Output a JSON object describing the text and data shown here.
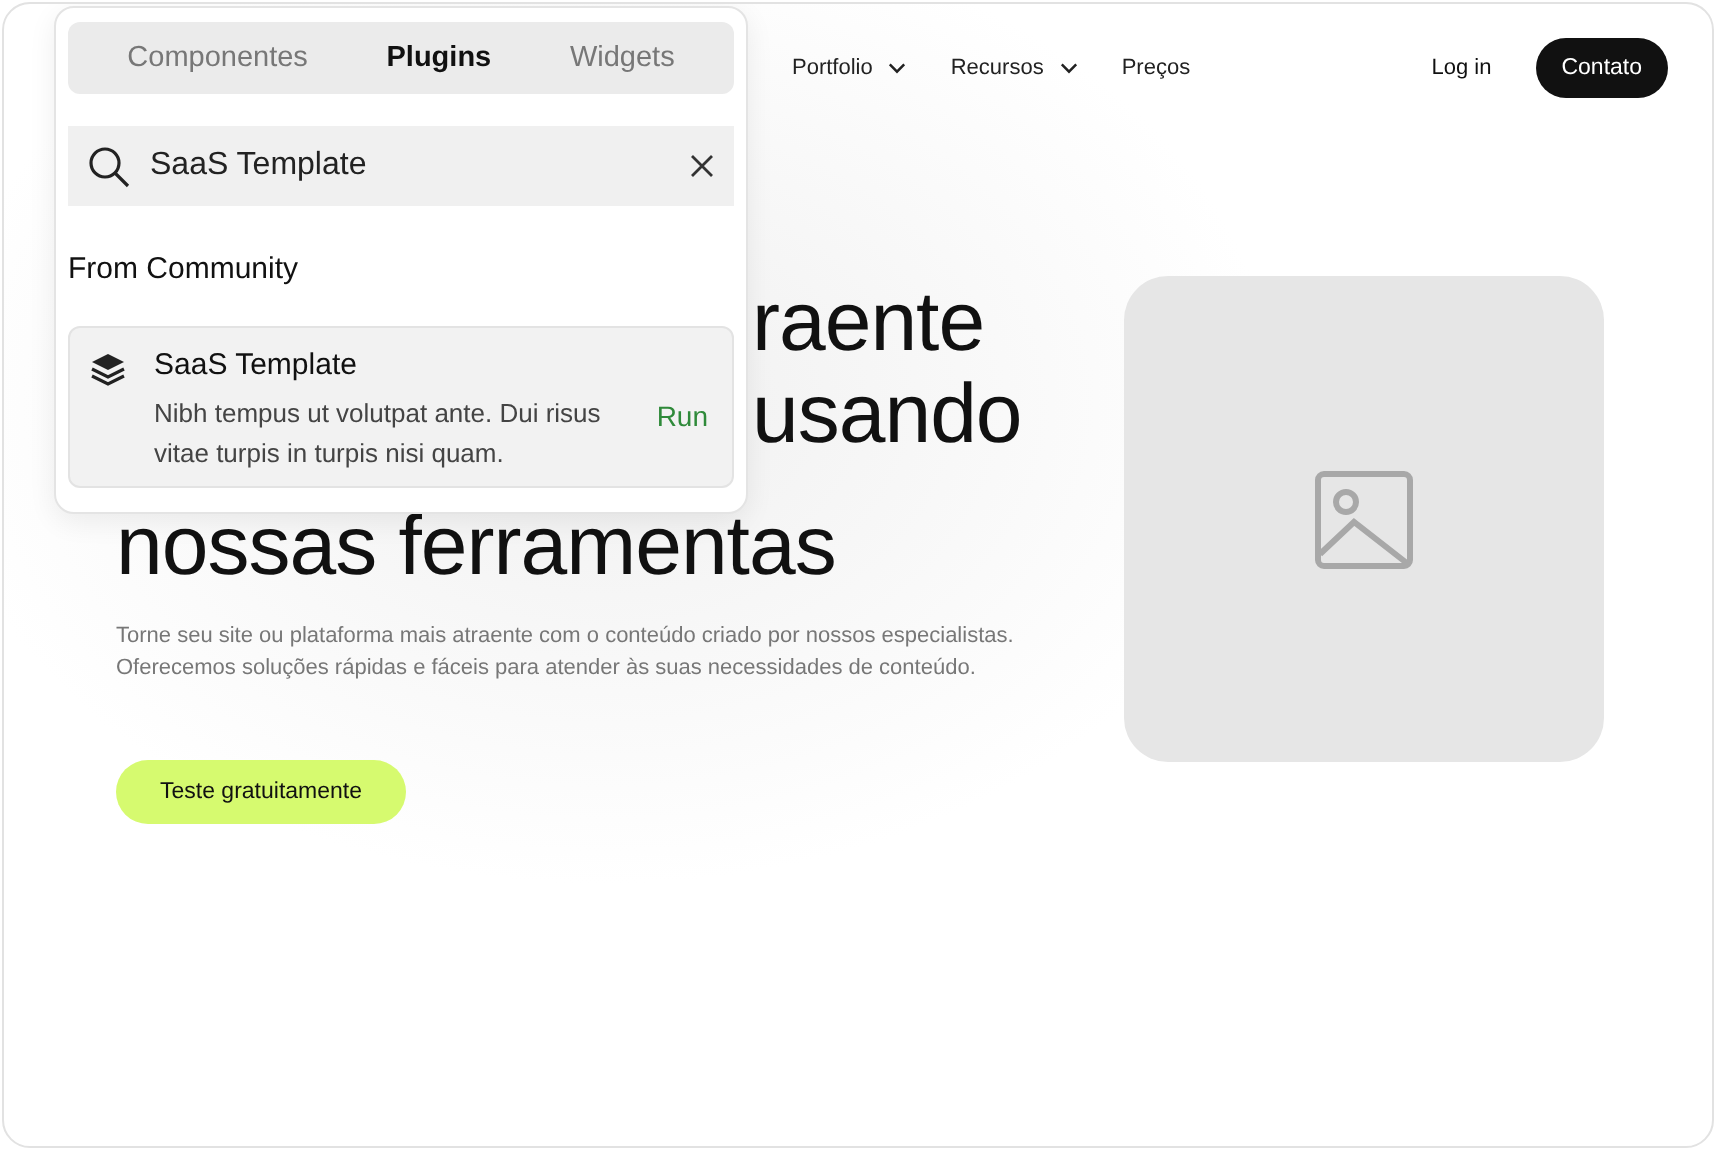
{
  "nav": {
    "items": [
      {
        "label": "Portfolio",
        "dropdown": true
      },
      {
        "label": "Recursos",
        "dropdown": true
      },
      {
        "label": "Preços",
        "dropdown": false
      }
    ],
    "login": "Log in",
    "cta": "Contato"
  },
  "hero": {
    "heading_lines": [
      "raente",
      "usando",
      "nossas ferramentas"
    ],
    "text": "Torne seu site ou plataforma mais atraente com o conteúdo criado por nossos especialistas. Oferecemos soluções rápidas e fáceis para atender às suas necessidades de conteúdo.",
    "button": "Teste gratuitamente",
    "image": {
      "kind": "placeholder"
    }
  },
  "popup": {
    "tabs": [
      {
        "label": "Componentes",
        "selected": false
      },
      {
        "label": "Plugins",
        "selected": true
      },
      {
        "label": "Widgets",
        "selected": false
      }
    ],
    "search": {
      "value": "SaaS Template"
    },
    "section": "From Community",
    "results": [
      {
        "title": "SaaS Template",
        "description": "Nibh tempus ut volutpat ante. Dui risus vitae turpis in turpis nisi quam.",
        "action": "Run"
      }
    ]
  }
}
